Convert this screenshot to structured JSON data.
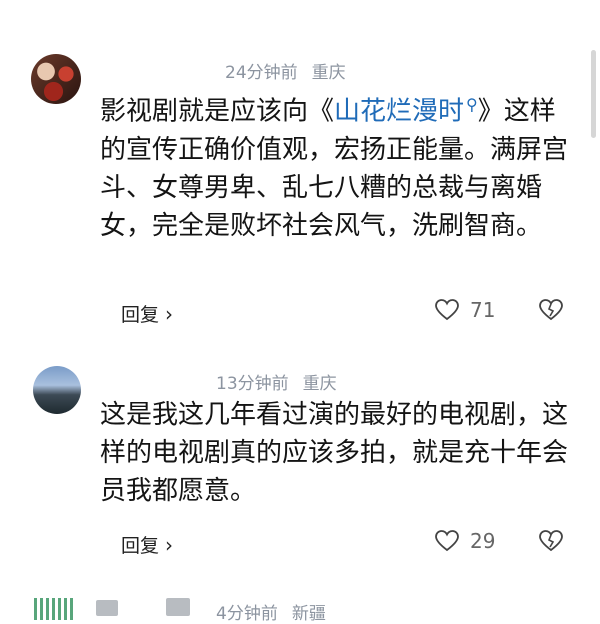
{
  "comments": [
    {
      "time": "24分钟前",
      "location": "重庆",
      "text_before": "影视剧就是应该向《",
      "link": "山花烂漫时",
      "text_after": "》这样的宣传正确价值观，宏扬正能量。满屏宫斗、女尊男卑、乱七八糟的总裁与离婚女，完全是败坏社会风气，洗刷智商。",
      "reply_label": "回复",
      "likes": "71"
    },
    {
      "time": "13分钟前",
      "location": "重庆",
      "text": "这是我这几年看过演的最好的电视剧，这样的电视剧真的应该多拍，就是充十年会员我都愿意。",
      "reply_label": "回复",
      "likes": "29"
    },
    {
      "time": "4分钟前",
      "location": "新疆"
    }
  ],
  "icons": {
    "reply_chevron": "chevron-right-icon",
    "like": "heart-icon",
    "dislike": "broken-heart-icon",
    "link_search": "search-icon"
  },
  "colors": {
    "link": "#1f6bb8",
    "meta": "#8c94a0"
  }
}
